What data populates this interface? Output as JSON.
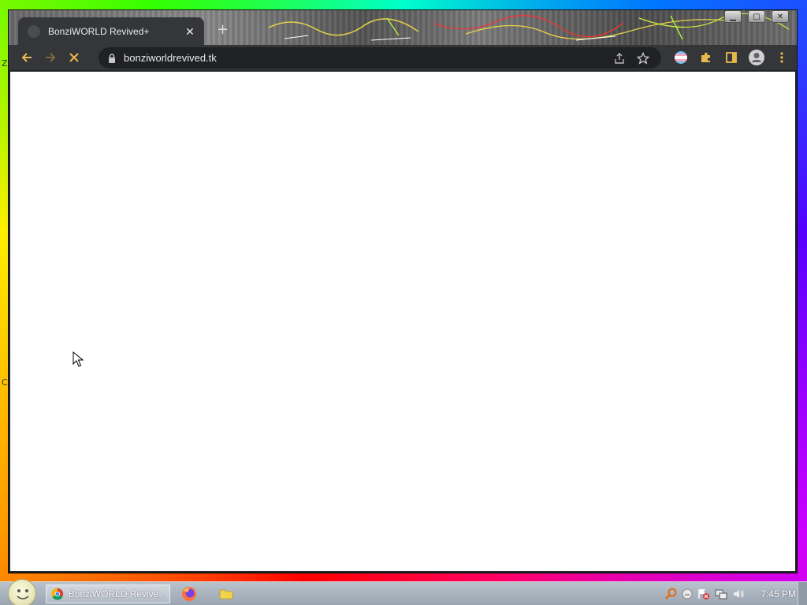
{
  "desktop": {
    "glyph_left_top": "Z",
    "glyph_left_mid": "C"
  },
  "browser": {
    "tab": {
      "title": "BonziWORLD Revived+",
      "favicon": "globe-icon",
      "close": "✕"
    },
    "new_tab_symbol": "+",
    "window_controls": {
      "minimize": "▁",
      "maximize": "▢",
      "close": "✕"
    },
    "toolbar": {
      "back": "back-arrow-icon",
      "forward": "forward-arrow-icon",
      "stop": "stop-loading-icon",
      "lock": "lock-icon",
      "url": "bonziworldrevived.tk",
      "share": "share-icon",
      "bookmark": "star-icon",
      "extension_flag": "flag-extension-icon",
      "extensions": "puzzle-icon",
      "side_panel": "side-panel-icon",
      "profile": "profile-icon",
      "menu": "kebab-menu-icon"
    },
    "accent_color": "#e8b94a"
  },
  "taskbar": {
    "task_label": "BonziWORLD Revive...",
    "pinned": [
      "firefox-icon",
      "folder-icon"
    ],
    "tray": [
      "search-icon",
      "emoji-icon",
      "network-error-icon",
      "network-icon",
      "volume-icon"
    ],
    "clock": "7:45 PM"
  }
}
